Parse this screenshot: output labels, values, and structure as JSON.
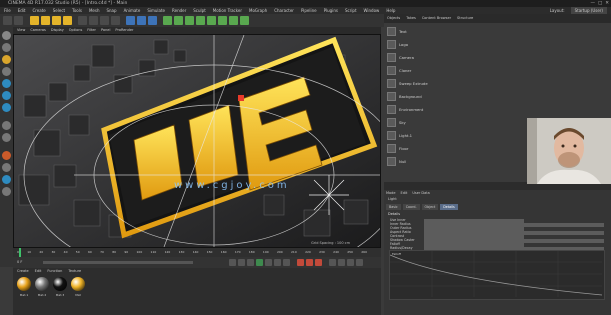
{
  "window": {
    "title": "CINEMA 4D R17.032 Studio (R5) - [Intro.c4d *] - Main"
  },
  "menu": {
    "items": [
      "File",
      "Edit",
      "Create",
      "Select",
      "Tools",
      "Mesh",
      "Snap",
      "Animate",
      "Simulate",
      "Render",
      "Sculpt",
      "Motion Tracker",
      "MoGraph",
      "Character",
      "Pipeline",
      "Plugins",
      "Script",
      "Window",
      "Help"
    ],
    "layout_label": "Layout:",
    "layout_value": "Startup (User)"
  },
  "viewport": {
    "menu": [
      "View",
      "Cameras",
      "Display",
      "Options",
      "Filter",
      "Panel",
      "ProRender"
    ],
    "hint": "Grid Spacing : 100 cm",
    "watermark": "www.cgjoy.com"
  },
  "timeline": {
    "ticks": [
      "0",
      "10",
      "20",
      "30",
      "40",
      "50",
      "60",
      "70",
      "80",
      "90",
      "100",
      "110",
      "120",
      "130",
      "140",
      "150",
      "160",
      "170",
      "180",
      "190",
      "200",
      "210",
      "220",
      "230",
      "240",
      "250",
      "260"
    ],
    "frame": "0 F"
  },
  "materials": {
    "menu": [
      "Create",
      "Edit",
      "Function",
      "Texture"
    ],
    "items": [
      {
        "label": "Mat.1",
        "color": "#e8a21a"
      },
      {
        "label": "Mat.2",
        "color": "#777777"
      },
      {
        "label": "Mat.3",
        "color": "#111111"
      },
      {
        "label": "Mat",
        "color": "#f0b428"
      }
    ]
  },
  "object_manager": {
    "tabs": [
      "Objects",
      "Takes",
      "Content Browser",
      "Structure"
    ],
    "rows": [
      "Text",
      "Logo",
      "Camera",
      "Cloner",
      "Sweep Extrude",
      "Background",
      "Environment",
      "Sky",
      "Light.1",
      "Floor",
      "Null"
    ]
  },
  "attributes": {
    "menu": [
      "Mode",
      "Edit",
      "User Data"
    ],
    "object_label": "Light",
    "tabs": [
      "Basic",
      "Coord.",
      "Object",
      "Details"
    ],
    "active_tab": "Details",
    "section": "Details",
    "rows": [
      "Use Inner",
      "Inner Radius",
      "Outer Radius",
      "Aspect Ratio",
      "Contrast",
      "Shadow Caster",
      "Falloff",
      "Radius/Decay"
    ],
    "graph_label": "Falloff"
  },
  "colors": {
    "accent": "#ffd21e",
    "panel": "#3a3a3a",
    "dark": "#222222"
  }
}
